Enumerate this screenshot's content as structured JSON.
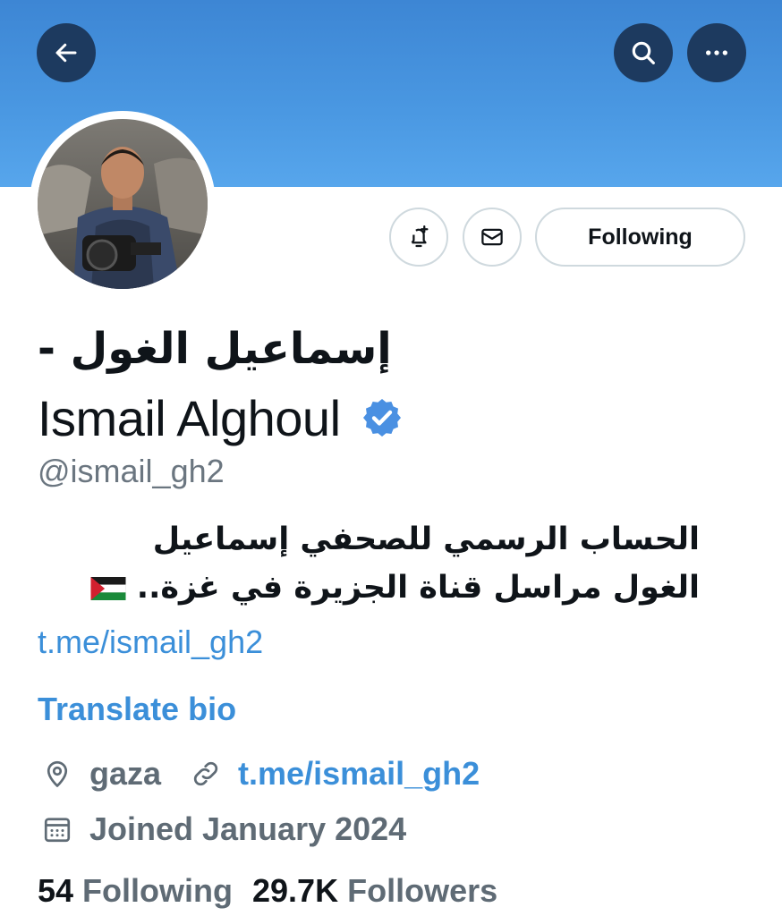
{
  "header": {
    "icons": [
      "back-arrow-icon",
      "search-icon",
      "more-icon"
    ],
    "banner_color": "#4a98e2"
  },
  "actions": {
    "notify_icon": "bell-plus-icon",
    "message_icon": "envelope-icon",
    "following_label": "Following"
  },
  "profile": {
    "arabic_name": "إسماعيل الغول -",
    "display_name": "Ismail Alghoul",
    "verified": true,
    "handle": "@ismail_gh2",
    "bio_line_1": "الحساب الرسمي للصحفي إسماعيل",
    "bio_line_2": "الغول مراسل قناة الجزيرة في غزة..",
    "bio_flag": "palestine-flag-icon",
    "bio_link": "t.me/ismail_gh2",
    "translate_label": "Translate bio",
    "location": "gaza",
    "website": "t.me/ismail_gh2",
    "joined": "Joined January 2024"
  },
  "stats": {
    "following_count": "54",
    "following_label": "Following",
    "followers_count": "29.7K",
    "followers_label": "Followers"
  },
  "colors": {
    "accent": "#3b8fd9",
    "verified": "#4a90e2",
    "header_button": "#1d3a5f"
  }
}
